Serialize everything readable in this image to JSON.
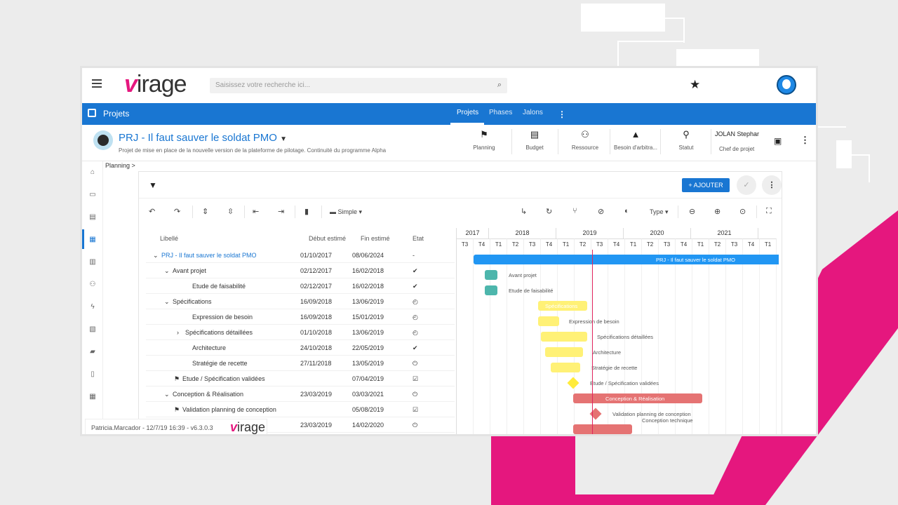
{
  "app": {
    "logo_v": "v",
    "logo_rest": "irage",
    "search_placeholder": "Saisissez votre recherche ici..."
  },
  "nav": {
    "module": "Projets",
    "tabs": [
      "Projets",
      "Phases",
      "Jalons"
    ]
  },
  "project": {
    "title": "PRJ - Il faut sauver le soldat PMO",
    "subtitle": "Projet de mise en place de la nouvelle version de la plateforme de pilotage. Continuité du programme Alpha",
    "header_items": [
      "Planning",
      "Budget",
      "Ressource",
      "Besoin d'arbitra...",
      "Statut"
    ],
    "manager_name": "JOLAN Stephar",
    "manager_role": "Chef de projet"
  },
  "breadcrumb": "Planning >",
  "toolbar": {
    "add_label": "+ AJOUTER",
    "view_label": "Simple",
    "type_label": "Type"
  },
  "grid": {
    "headers": {
      "label": "Libellé",
      "start": "Début estimé",
      "end": "Fin estimé",
      "state": "Etat"
    },
    "rows": [
      {
        "label": "PRJ - Il faut sauver le soldat PMO",
        "start": "01/10/2017",
        "end": "08/06/2024",
        "state": "-"
      },
      {
        "label": "Avant projet",
        "start": "02/12/2017",
        "end": "16/02/2018",
        "state": "✔"
      },
      {
        "label": "Etude de faisabilité",
        "start": "02/12/2017",
        "end": "16/02/2018",
        "state": "✔"
      },
      {
        "label": "Spécifications",
        "start": "16/09/2018",
        "end": "13/06/2019",
        "state": "◴"
      },
      {
        "label": "Expression de besoin",
        "start": "16/09/2018",
        "end": "15/01/2019",
        "state": "◴"
      },
      {
        "label": "Spécifications détaillées",
        "start": "01/10/2018",
        "end": "13/06/2019",
        "state": "◴"
      },
      {
        "label": "Architecture",
        "start": "24/10/2018",
        "end": "22/05/2019",
        "state": "✔"
      },
      {
        "label": "Stratégie de recette",
        "start": "27/11/2018",
        "end": "13/05/2019",
        "state": "⏻"
      },
      {
        "label": "Etude / Spécification validées",
        "start": "",
        "end": "07/04/2019",
        "state": "☑"
      },
      {
        "label": "Conception & Réalisation",
        "start": "23/03/2019",
        "end": "03/03/2021",
        "state": "⏻"
      },
      {
        "label": "Validation planning de conception",
        "start": "",
        "end": "05/08/2019",
        "state": "☑"
      },
      {
        "label": "",
        "start": "23/03/2019",
        "end": "14/02/2020",
        "state": "⏻"
      }
    ]
  },
  "gantt": {
    "years": [
      "2017",
      "2018",
      "2019",
      "2020",
      "2021"
    ],
    "quarters": [
      "T3",
      "T4",
      "T1",
      "T2",
      "T3",
      "T4",
      "T1",
      "T2",
      "T3",
      "T4",
      "T1",
      "T2",
      "T3",
      "T4",
      "T1",
      "T2",
      "T3",
      "T4",
      "T1"
    ],
    "labels": [
      "PRJ - Il faut sauver le soldat PMO",
      "Avant projet",
      "Etude de faisabilité",
      "Spécifications",
      "Expression de besoin",
      "Spécifications détaillées",
      "Architecture",
      "Stratégie de recette",
      "Etude / Spécification validées",
      "Conception & Réalisation",
      "Validation planning de conception",
      "Conception technique"
    ]
  },
  "footer": {
    "user": "Patricia.Marcador - 12/7/19 16:39 - v6.3.0.3",
    "logo_v": "v",
    "logo_rest": "irage"
  }
}
